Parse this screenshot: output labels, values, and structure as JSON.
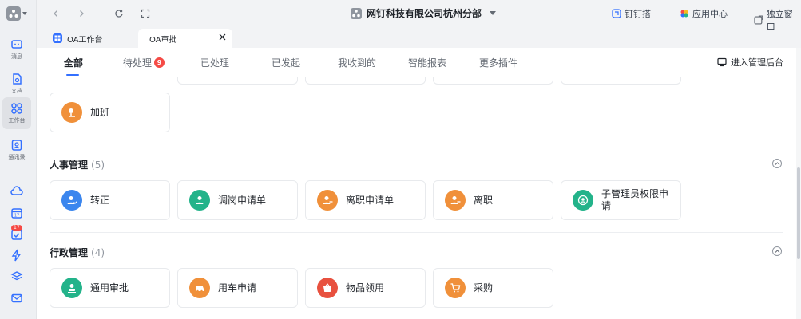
{
  "rail": {
    "items": [
      {
        "label": "消息",
        "icon": "message-icon"
      },
      {
        "label": "文档",
        "icon": "doc-icon"
      },
      {
        "label": "工作台",
        "icon": "workbench-icon"
      },
      {
        "label": "通讯录",
        "icon": "contacts-icon"
      }
    ],
    "calendar_badge": "17",
    "accent": "#3370ff"
  },
  "topbar": {
    "title": "网钉科技有限公司杭州分部",
    "links": [
      "钉钉搭",
      "应用中心",
      "独立窗口"
    ]
  },
  "tabs": {
    "first": "OA工作台",
    "second": "OA审批"
  },
  "subnav": {
    "tabs": [
      "全部",
      "待处理",
      "已处理",
      "已发起",
      "我收到的",
      "智能报表",
      "更多插件"
    ],
    "pending_count": "9",
    "admin_link": "进入管理后台"
  },
  "sections": {
    "overtime": {
      "label": "加班"
    },
    "hr": {
      "title": "人事管理",
      "count": "(5)",
      "items": [
        "转正",
        "调岗申请单",
        "离职申请单",
        "离职",
        "子管理员权限申请"
      ]
    },
    "admin": {
      "title": "行政管理",
      "count": "(4)",
      "items": [
        "通用审批",
        "用车申请",
        "物品领用",
        "采购"
      ]
    }
  },
  "colors": {
    "orange": "#f0903a",
    "blue": "#3b86ee",
    "green": "#23b38a",
    "red": "#e8513f",
    "badge": "#f54a45"
  }
}
